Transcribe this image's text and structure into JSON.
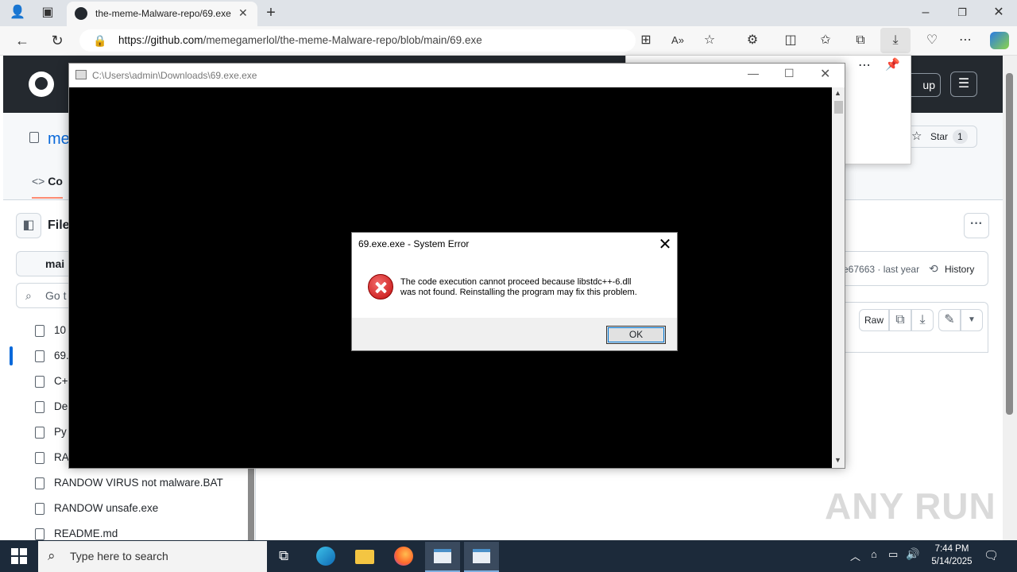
{
  "browser": {
    "tab_title": "the-meme-Malware-repo/69.exe",
    "url_host": "https://github.com",
    "url_path": "/memegamerlol/the-meme-Malware-repo/blob/main/69.exe"
  },
  "github": {
    "signup_label": "up",
    "repo_name": "me",
    "star_label": "Star",
    "star_count": "1",
    "code_tab": "Co",
    "files_label": "File",
    "branch": "mai",
    "goto_placeholder": "Go t",
    "files": [
      "10",
      "69.",
      "C+",
      "De",
      "Py",
      "RA",
      "RANDOW VIRUS not malware.BAT",
      "RANDOW unsafe.exe",
      "README.md"
    ],
    "commit_info": "e67663 · last year",
    "history_label": "History",
    "raw_label": "Raw"
  },
  "console": {
    "title": "C:\\Users\\admin\\Downloads\\69.exe.exe"
  },
  "dialog": {
    "title": "69.exe.exe - System Error",
    "message_line1": "The code execution cannot proceed because libstdc++-6.dll",
    "message_line2": "was not found. Reinstalling the program may fix this problem.",
    "ok_label": "OK"
  },
  "taskbar": {
    "search_placeholder": "Type here to search",
    "time": "7:44 PM",
    "date": "5/14/2025"
  },
  "watermark": "ANY RUN",
  "colors": {
    "gh_header": "#24292f",
    "link": "#0969da",
    "error_red": "#c40f0f",
    "taskbar": "#1c2a3a"
  }
}
